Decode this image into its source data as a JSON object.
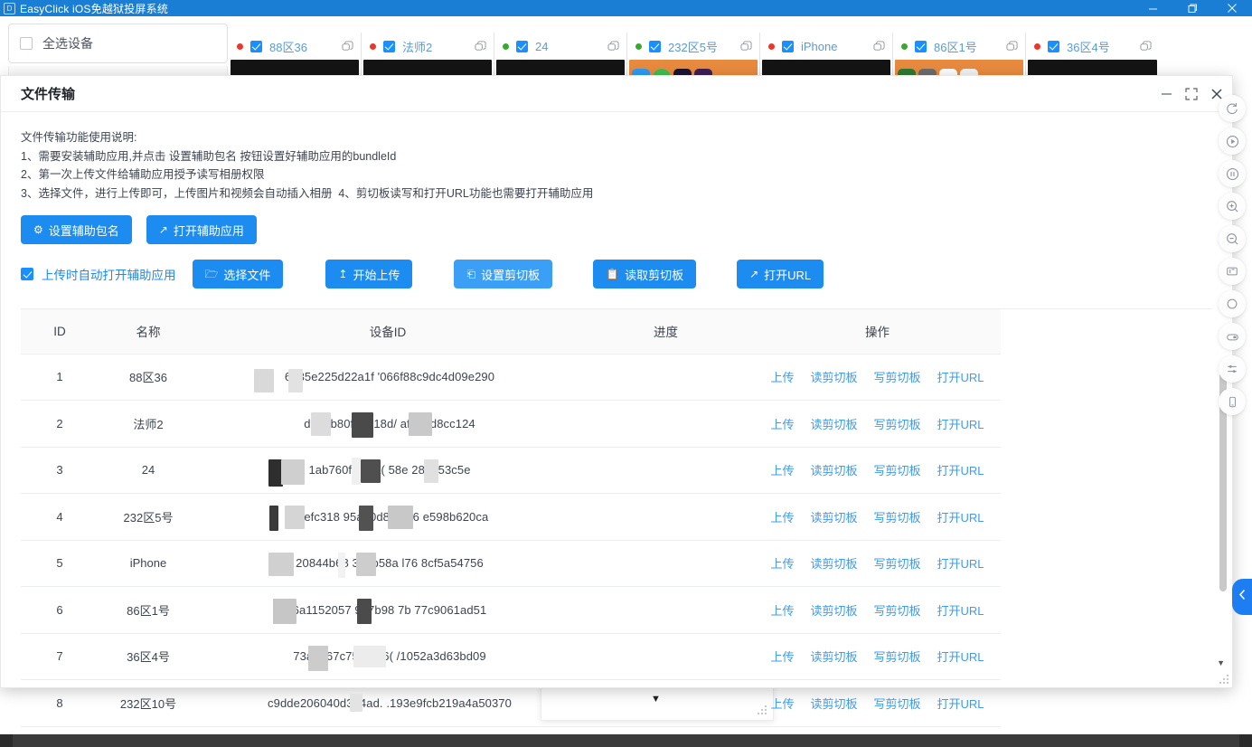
{
  "window": {
    "title": "EasyClick iOS免越狱投屏系统",
    "icon": "app-icon",
    "controls": {
      "minimize": "minimize-icon",
      "restore": "restore-icon",
      "close": "close-icon"
    }
  },
  "toolbar": {
    "select_all_label": "全选设备",
    "select_all_checked": false
  },
  "devices": [
    {
      "name": "88区36",
      "status": "red",
      "checked": true,
      "screen": "black"
    },
    {
      "name": "法师2",
      "status": "red",
      "checked": true,
      "screen": "black"
    },
    {
      "name": "24",
      "status": "green",
      "checked": true,
      "screen": "black"
    },
    {
      "name": "232区5号",
      "status": "green",
      "checked": true,
      "screen": "home"
    },
    {
      "name": "iPhone",
      "status": "red",
      "checked": true,
      "screen": "black"
    },
    {
      "name": "86区1号",
      "status": "green",
      "checked": true,
      "screen": "home2"
    },
    {
      "name": "36区4号",
      "status": "red",
      "checked": true,
      "screen": "black"
    }
  ],
  "dialog": {
    "title": "文件传输",
    "controls": {
      "minimize": "minimize-icon",
      "maximize": "fullscreen-icon",
      "close": "close-icon"
    },
    "help_text": "文件传输功能使用说明:\n1、需要安装辅助应用,并点击 设置辅助包名 按钮设置好辅助应用的bundleId\n2、第一次上传文件给辅助应用授予读写相册权限\n3、选择文件，进行上传即可，上传图片和视频会自动插入相册  4、剪切板读写和打开URL功能也需要打开辅助应用",
    "buttons_row1": [
      {
        "label": "设置辅助包名",
        "icon": "gear-icon"
      },
      {
        "label": "打开辅助应用",
        "icon": "arrow-up-right-icon"
      }
    ],
    "auto_open": {
      "label": "上传时自动打开辅助应用",
      "checked": true
    },
    "buttons_row2": [
      {
        "label": "选择文件",
        "icon": "folder-icon"
      },
      {
        "label": "开始上传",
        "icon": "upload-icon"
      },
      {
        "label": "设置剪切板",
        "icon": "clipboard-icon"
      },
      {
        "label": "读取剪切板",
        "icon": "clipboard-read-icon"
      },
      {
        "label": "打开URL",
        "icon": "arrow-up-right-icon"
      }
    ],
    "table": {
      "columns": [
        "ID",
        "名称",
        "设备ID",
        "进度",
        "操作"
      ],
      "row_actions": [
        "上传",
        "读剪切板",
        "写剪切板",
        "打开URL"
      ],
      "rows": [
        {
          "id": "1",
          "name": "88区36",
          "device_id": "6535e225d22a1f      '066f88c9dc4d09e290",
          "progress": ""
        },
        {
          "id": "2",
          "name": "法师2",
          "device_id": "d774b80f44   ,18d/    afafd    d8cc124",
          "progress": ""
        },
        {
          "id": "3",
          "name": "24",
          "device_id": "1ab760f2   9ca(     58e    286053c5e",
          "progress": ""
        },
        {
          "id": "4",
          "name": "232区5号",
          "device_id": "98efc318   95a10d80   156   e598b620ca",
          "progress": ""
        },
        {
          "id": "5",
          "name": "iPhone",
          "device_id": "20844b68   387b58a   l76    8cf5a54756",
          "progress": ""
        },
        {
          "id": "6",
          "name": "86区1号",
          "device_id": "6a1152057   9a7b98    7b   77c9061ad51",
          "progress": ""
        },
        {
          "id": "7",
          "name": "36区4号",
          "device_id": "73aae67c75S   9c6(     /1052a3d63bd09",
          "progress": ""
        },
        {
          "id": "8",
          "name": "232区10号",
          "device_id": "c9dde206040d3d4ad. .193e9fcb219a4a50370",
          "progress": ""
        }
      ]
    }
  },
  "rail": {
    "items": [
      {
        "icon": "refresh-icon"
      },
      {
        "icon": "play-circle-icon"
      },
      {
        "icon": "pause-circle-icon"
      },
      {
        "icon": "zoom-in-icon"
      },
      {
        "icon": "zoom-out-icon"
      },
      {
        "icon": "screenshot-icon"
      },
      {
        "icon": "circle-icon"
      },
      {
        "icon": "toggle-icon"
      },
      {
        "icon": "sliders-icon"
      },
      {
        "icon": "phone-icon"
      }
    ],
    "collapse": {
      "icon": "chevron-left-icon"
    }
  },
  "colors": {
    "titlebar": "#1a7fd4",
    "primary": "#1c8cf0",
    "link": "#3d9bf0",
    "status_online": "#3aa830",
    "status_offline": "#e8372c"
  }
}
